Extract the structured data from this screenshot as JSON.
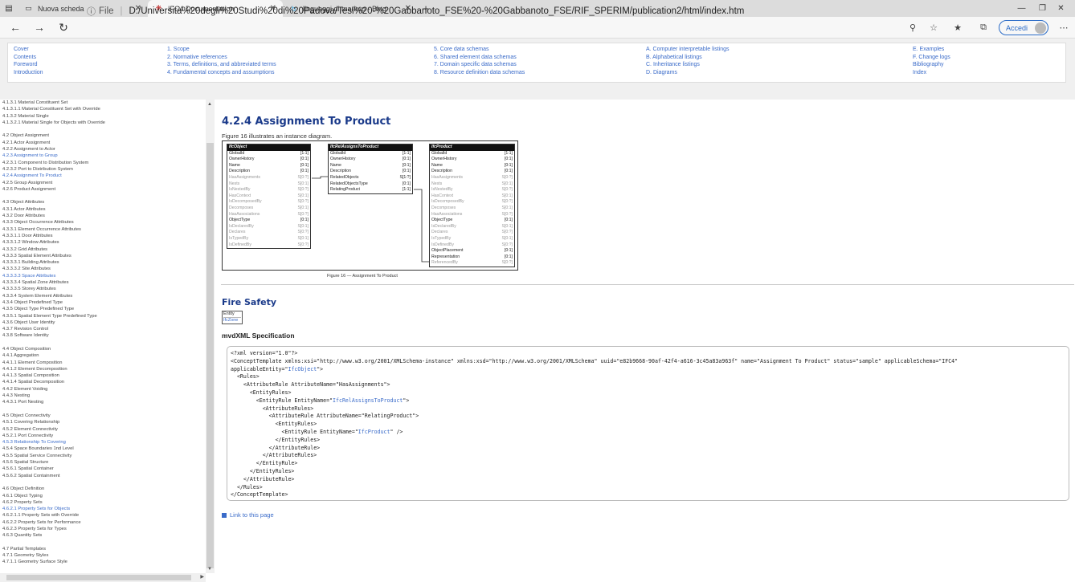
{
  "browser": {
    "tabs": [
      {
        "title": "Nuova scheda",
        "icon": "page-icon",
        "active": false
      },
      {
        "title": "IFC4 Documentation",
        "icon": "ifc-icon",
        "active": true
      },
      {
        "title": "linguaggi di markup - Bing",
        "icon": "bing-icon",
        "active": false
      }
    ],
    "url_prefix": "File",
    "url": "D:/Università%20degli%20Studi%20di%20Padova/Tesi%20-%20Gabbanoto_FSE%20-%20Gabbanoto_FSE/RIF_SPERIM/publication2/html/index.htm",
    "accedi_label": "Accedi"
  },
  "header": {
    "col1": [
      "Cover",
      "Contents",
      "Foreword",
      "Introduction"
    ],
    "col2": [
      "1. Scope",
      "2. Normative references",
      "3. Terms, definitions, and abbreviated terms",
      "4. Fundamental concepts and assumptions"
    ],
    "col3": [
      "5. Core data schemas",
      "6. Shared element data schemas",
      "7. Domain specific data schemas",
      "8. Resource definition data schemas"
    ],
    "col4": [
      "A. Computer interpretable listings",
      "B. Alphabetical listings",
      "C. Inheritance listings",
      "D. Diagrams"
    ],
    "col5": [
      "E. Examples",
      "F. Change logs",
      "Bibliography",
      "Index"
    ]
  },
  "sidebar": {
    "items": [
      {
        "label": "4.1.3.1 Material Constituent Set",
        "hl": false
      },
      {
        "label": "4.1.3.1.1 Material Constituent Set with Override",
        "hl": false
      },
      {
        "label": "4.1.3.2 Material Single",
        "hl": false
      },
      {
        "label": "4.1.3.2.1 Material Single for Objects with Override",
        "hl": false
      },
      {
        "label": "",
        "gap": true
      },
      {
        "label": "4.2 Object Assignment",
        "hl": false
      },
      {
        "label": "4.2.1 Actor Assignment",
        "hl": false
      },
      {
        "label": "4.2.2 Assignment to Actor",
        "hl": false
      },
      {
        "label": "4.2.3 Assignment to Group",
        "hl": true
      },
      {
        "label": "4.2.3.1 Component to Distribution System",
        "hl": false
      },
      {
        "label": "4.2.3.2 Port to Distribution System",
        "hl": false
      },
      {
        "label": "4.2.4 Assignment To Product",
        "hl": true
      },
      {
        "label": "4.2.5 Group Assignment",
        "hl": false
      },
      {
        "label": "4.2.6 Product Assignment",
        "hl": false
      },
      {
        "label": "",
        "gap": true
      },
      {
        "label": "4.3 Object Attributes",
        "hl": false
      },
      {
        "label": "4.3.1 Actor Attributes",
        "hl": false
      },
      {
        "label": "4.3.2 Door Attributes",
        "hl": false
      },
      {
        "label": "4.3.3 Object Occurrence Attributes",
        "hl": false
      },
      {
        "label": "4.3.3.1 Element Occurrence Attributes",
        "hl": false
      },
      {
        "label": "4.3.3.1.1 Door Attributes",
        "hl": false
      },
      {
        "label": "4.3.3.1.2 Window Attributes",
        "hl": false
      },
      {
        "label": "4.3.3.2 Grid Attributes",
        "hl": false
      },
      {
        "label": "4.3.3.3 Spatial Element Attributes",
        "hl": false
      },
      {
        "label": "4.3.3.3.1 Building Attributes",
        "hl": false
      },
      {
        "label": "4.3.3.3.2 Site Attributes",
        "hl": false
      },
      {
        "label": "4.3.3.3.3 Space Attributes",
        "hl": true
      },
      {
        "label": "4.3.3.3.4 Spatial Zone Attributes",
        "hl": false
      },
      {
        "label": "4.3.3.3.5 Storey Attributes",
        "hl": false
      },
      {
        "label": "4.3.3.4 System Element Attributes",
        "hl": false
      },
      {
        "label": "4.3.4 Object Predefined Type",
        "hl": false
      },
      {
        "label": "4.3.5 Object Type Predefined Type",
        "hl": false
      },
      {
        "label": "4.3.5.1 Spatial Element Type Predefined Type",
        "hl": false
      },
      {
        "label": "4.3.6 Object User Identity",
        "hl": false
      },
      {
        "label": "4.3.7 Revision Control",
        "hl": false
      },
      {
        "label": "4.3.8 Software Identity",
        "hl": false
      },
      {
        "label": "",
        "gap": true
      },
      {
        "label": "4.4 Object Composition",
        "hl": false
      },
      {
        "label": "4.4.1 Aggregation",
        "hl": false
      },
      {
        "label": "4.4.1.1 Element Composition",
        "hl": false
      },
      {
        "label": "4.4.1.2 Element Decomposition",
        "hl": false
      },
      {
        "label": "4.4.1.3 Spatial Composition",
        "hl": false
      },
      {
        "label": "4.4.1.4 Spatial Decomposition",
        "hl": false
      },
      {
        "label": "4.4.2 Element Voiding",
        "hl": false
      },
      {
        "label": "4.4.3 Nesting",
        "hl": false
      },
      {
        "label": "4.4.3.1 Port Nesting",
        "hl": false
      },
      {
        "label": "",
        "gap": true
      },
      {
        "label": "4.5 Object Connectivity",
        "hl": false
      },
      {
        "label": "4.5.1 Covering Relationship",
        "hl": false
      },
      {
        "label": "4.5.2 Element Connectivity",
        "hl": false
      },
      {
        "label": "4.5.2.1 Port Connectivity",
        "hl": false
      },
      {
        "label": "4.5.3 Relationship To Covering",
        "hl": true
      },
      {
        "label": "4.5.4 Space Boundaries 1nd Level",
        "hl": false
      },
      {
        "label": "4.5.5 Spatial Service Connectivity",
        "hl": false
      },
      {
        "label": "4.5.6 Spatial Structure",
        "hl": false
      },
      {
        "label": "4.5.6.1 Spatial Container",
        "hl": false
      },
      {
        "label": "4.5.6.2 Spatial Containment",
        "hl": false
      },
      {
        "label": "",
        "gap": true
      },
      {
        "label": "4.6 Object Definition",
        "hl": false
      },
      {
        "label": "4.6.1 Object Typing",
        "hl": false
      },
      {
        "label": "4.6.2 Property Sets",
        "hl": false
      },
      {
        "label": "4.6.2.1 Property Sets for Objects",
        "hl": true
      },
      {
        "label": "4.6.2.1.1 Property Sets with Override",
        "hl": false
      },
      {
        "label": "4.6.2.2 Property Sets for Performance",
        "hl": false
      },
      {
        "label": "4.6.2.3 Property Sets for Types",
        "hl": false
      },
      {
        "label": "4.6.3 Quantity Sets",
        "hl": false
      },
      {
        "label": "",
        "gap": true
      },
      {
        "label": "4.7 Partial Templates",
        "hl": false
      },
      {
        "label": "4.7.1 Geometry Styles",
        "hl": false
      },
      {
        "label": "4.7.1.1 Geometry Surface Style",
        "hl": false
      }
    ]
  },
  "main": {
    "title": "4.2.4 Assignment To Product",
    "intro": "Figure 16 illustrates an instance diagram.",
    "figure_caption": "Figure 16 — Assignment To Product",
    "fire_title": "Fire Safety",
    "entity_label": "Entity",
    "entity_value": "IfcZone",
    "mvd_title": "mvdXML Specification",
    "link_label": "Link to this page"
  },
  "diagram": {
    "entities": [
      {
        "name": "IfcObject",
        "rows": [
          [
            "GlobalId",
            "[1:1]",
            false
          ],
          [
            "OwnerHistory",
            "[0:1]",
            false
          ],
          [
            "Name",
            "[0:1]",
            false
          ],
          [
            "Description",
            "[0:1]",
            false
          ],
          [
            "HasAssignments",
            "S[0:?]",
            true
          ],
          [
            "Nests",
            "S[0:1]",
            true
          ],
          [
            "IsNestedBy",
            "S[0:?]",
            true
          ],
          [
            "HasContext",
            "S[0:1]",
            true
          ],
          [
            "IsDecomposedBy",
            "S[0:?]",
            true
          ],
          [
            "Decomposes",
            "S[0:1]",
            true
          ],
          [
            "HasAssociations",
            "S[0:?]",
            true
          ],
          [
            "ObjectType",
            "[0:1]",
            false
          ],
          [
            "IsDeclaredBy",
            "S[0:1]",
            true
          ],
          [
            "Declares",
            "S[0:?]",
            true
          ],
          [
            "IsTypedBy",
            "S[0:1]",
            true
          ],
          [
            "IsDefinedBy",
            "S[0:?]",
            true
          ]
        ]
      },
      {
        "name": "IfcRelAssignsToProduct",
        "rows": [
          [
            "GlobalId",
            "[1:1]",
            false
          ],
          [
            "OwnerHistory",
            "[0:1]",
            false
          ],
          [
            "Name",
            "[0:1]",
            false
          ],
          [
            "Description",
            "[0:1]",
            false
          ],
          [
            "RelatedObjects",
            "S[1:?]",
            false
          ],
          [
            "RelatedObjectsType",
            "[0:1]",
            false
          ],
          [
            "RelatingProduct",
            "[1:1]",
            false
          ]
        ]
      },
      {
        "name": "IfcProduct",
        "rows": [
          [
            "GlobalId",
            "[1:1]",
            false
          ],
          [
            "OwnerHistory",
            "[0:1]",
            false
          ],
          [
            "Name",
            "[0:1]",
            false
          ],
          [
            "Description",
            "[0:1]",
            false
          ],
          [
            "HasAssignments",
            "S[0:?]",
            true
          ],
          [
            "Nests",
            "S[0:1]",
            true
          ],
          [
            "IsNestedBy",
            "S[0:?]",
            true
          ],
          [
            "HasContext",
            "S[0:1]",
            true
          ],
          [
            "IsDecomposedBy",
            "S[0:?]",
            true
          ],
          [
            "Decomposes",
            "S[0:1]",
            true
          ],
          [
            "HasAssociations",
            "S[0:?]",
            true
          ],
          [
            "ObjectType",
            "[0:1]",
            false
          ],
          [
            "IsDeclaredBy",
            "S[0:1]",
            true
          ],
          [
            "Declares",
            "S[0:?]",
            true
          ],
          [
            "IsTypedBy",
            "S[0:1]",
            true
          ],
          [
            "IsDefinedBy",
            "S[0:?]",
            true
          ],
          [
            "ObjectPlacement",
            "[0:1]",
            false
          ],
          [
            "Representation",
            "[0:1]",
            false
          ],
          [
            "ReferencedBy",
            "S[0:?]",
            true
          ]
        ]
      }
    ]
  },
  "code_lines": [
    [
      "<?xml version=\"1.0\"?>"
    ],
    [
      "<ConceptTemplate xmlns:xsi=\"http://www.w3.org/2001/XMLSchema-instance\" xmlns:xsd=\"http://www.w3.org/2001/XMLSchema\" uuid=\"e82b9668-90af-42f4-a616-3c45a83a963f\" name=\"Assignment To Product\" status=\"sample\" applicableSchema=\"IFC4\""
    ],
    [
      "applicableEntity=\"",
      "IfcObject",
      "\">"
    ],
    [
      "  <Rules>"
    ],
    [
      "    <AttributeRule AttributeName=\"HasAssignments\">"
    ],
    [
      "      <EntityRules>"
    ],
    [
      "        <EntityRule EntityName=\"",
      "IfcRelAssignsToProduct",
      "\">"
    ],
    [
      "          <AttributeRules>"
    ],
    [
      "            <AttributeRule AttributeName=\"RelatingProduct\">"
    ],
    [
      "              <EntityRules>"
    ],
    [
      "                <EntityRule EntityName=\"",
      "IfcProduct",
      "\" />"
    ],
    [
      "              </EntityRules>"
    ],
    [
      "            </AttributeRule>"
    ],
    [
      "          </AttributeRules>"
    ],
    [
      "        </EntityRule>"
    ],
    [
      "      </EntityRules>"
    ],
    [
      "    </AttributeRule>"
    ],
    [
      "  </Rules>"
    ],
    [
      "</ConceptTemplate>"
    ]
  ]
}
